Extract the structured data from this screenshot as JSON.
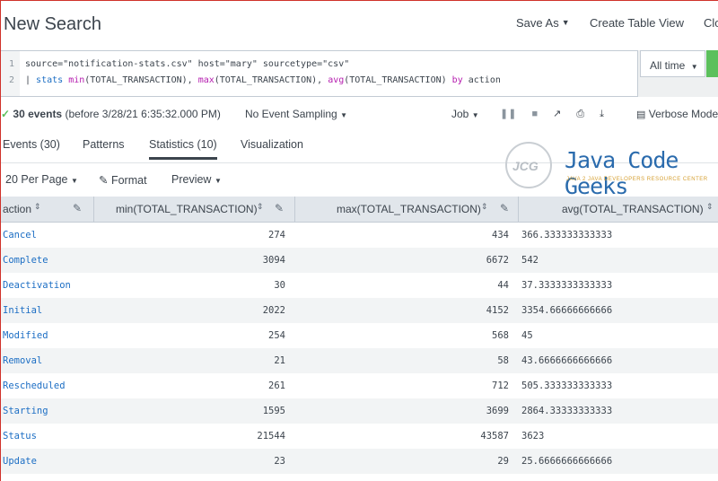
{
  "header": {
    "title": "New Search",
    "save_as": "Save As",
    "create_table_view": "Create Table View",
    "close": "Clo"
  },
  "search": {
    "line_numbers": [
      "1",
      "2"
    ],
    "line1": "source=\"notification-stats.csv\" host=\"mary\" sourcetype=\"csv\"",
    "line2_pipe": "| ",
    "line2_cmd": "stats",
    "line2_sp1": " ",
    "line2_fn1": "min",
    "line2_arg1": "(TOTAL_TRANSACTION), ",
    "line2_fn2": "max",
    "line2_arg2": "(TOTAL_TRANSACTION), ",
    "line2_fn3": "avg",
    "line2_arg3": "(TOTAL_TRANSACTION) ",
    "line2_by": "by",
    "line2_field": " action",
    "time_range": "All time"
  },
  "status": {
    "events_count": "30 events",
    "events_before": "(before 3/28/21 6:35:32.000 PM)",
    "sampling": "No Event Sampling",
    "job": "Job",
    "verbose_mode": "Verbose Mode"
  },
  "tabs": [
    {
      "label": "Events (30)"
    },
    {
      "label": "Patterns"
    },
    {
      "label": "Statistics (10)"
    },
    {
      "label": "Visualization"
    }
  ],
  "logo": {
    "monogram": "JCG",
    "name": "Java Code Geeks",
    "tagline": "JAVA 2 JAVA DEVELOPERS RESOURCE CENTER"
  },
  "toolbar": {
    "per_page": "20 Per Page",
    "format": "Format",
    "preview": "Preview"
  },
  "table": {
    "columns": [
      "action",
      "min(TOTAL_TRANSACTION)",
      "max(TOTAL_TRANSACTION)",
      "avg(TOTAL_TRANSACTION)"
    ],
    "rows": [
      [
        "Cancel",
        "274",
        "434",
        "366.333333333333"
      ],
      [
        "Complete",
        "3094",
        "6672",
        "542"
      ],
      [
        "Deactivation",
        "30",
        "44",
        "37.3333333333333"
      ],
      [
        "Initial",
        "2022",
        "4152",
        "3354.66666666666"
      ],
      [
        "Modified",
        "254",
        "568",
        "45"
      ],
      [
        "Removal",
        "21",
        "58",
        "43.6666666666666"
      ],
      [
        "Rescheduled",
        "261",
        "712",
        "505.333333333333"
      ],
      [
        "Starting",
        "1595",
        "3699",
        "2864.33333333333"
      ],
      [
        "Status",
        "21544",
        "43587",
        "3623"
      ],
      [
        "Update",
        "23",
        "29",
        "25.6666666666666"
      ]
    ]
  }
}
